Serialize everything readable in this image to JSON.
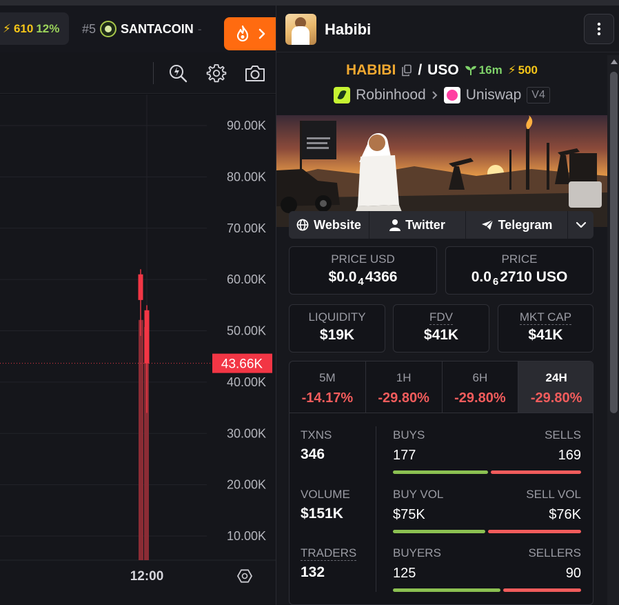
{
  "trending": {
    "prev_value": "610",
    "prev_change": "12%",
    "rank": "#5",
    "name": "SANTACOIN",
    "trail": "-"
  },
  "chart": {
    "y_ticks": [
      "90.00K",
      "80.00K",
      "70.00K",
      "60.00K",
      "50.00K",
      "40.00K",
      "30.00K",
      "20.00K",
      "10.00K"
    ],
    "current_price_label": "43.66K",
    "x_tick": "12:00",
    "colors": {
      "down": "#f23645",
      "volume": "#8b2c35"
    },
    "candles": [
      {
        "open": 56000,
        "close": 61000,
        "high": 62000,
        "low": 49000,
        "color": "down"
      },
      {
        "open": 54000,
        "close": 43660,
        "high": 55000,
        "low": 34000,
        "color": "down"
      }
    ],
    "volume_relative": [
      0.68,
      0.66
    ]
  },
  "token": {
    "name": "Habibi",
    "base_symbol": "HABIBI",
    "quote_symbol": "USO",
    "age": "16m",
    "boosts": "500",
    "chain": "Robinhood",
    "dex": "Uniswap",
    "dex_version": "V4"
  },
  "links": [
    "Website",
    "Twitter",
    "Telegram"
  ],
  "price": {
    "usd_label": "PRICE USD",
    "usd_prefix": "$0.0",
    "usd_zeros": "4",
    "usd_digits": "4366",
    "native_label": "PRICE",
    "native_prefix": "0.0",
    "native_zeros": "6",
    "native_digits": "2710 USO"
  },
  "metrics": [
    {
      "label": "LIQUIDITY",
      "value": "$19K"
    },
    {
      "label": "FDV",
      "value": "$41K"
    },
    {
      "label": "MKT CAP",
      "value": "$41K"
    }
  ],
  "timeframes": [
    {
      "label": "5M",
      "change": "-14.17%"
    },
    {
      "label": "1H",
      "change": "-29.80%"
    },
    {
      "label": "6H",
      "change": "-29.80%"
    },
    {
      "label": "24H",
      "change": "-29.80%"
    }
  ],
  "stats": {
    "txns": {
      "label": "TXNS",
      "value": "346"
    },
    "buys": {
      "label": "BUYS",
      "value": "177"
    },
    "sells": {
      "label": "SELLS",
      "value": "169"
    },
    "volume": {
      "label": "VOLUME",
      "value": "$151K"
    },
    "buy_vol": {
      "label": "BUY VOL",
      "value": "$75K"
    },
    "sell_vol": {
      "label": "SELL VOL",
      "value": "$76K"
    },
    "traders": {
      "label": "TRADERS",
      "value": "132"
    },
    "buyers": {
      "label": "BUYERS",
      "value": "125"
    },
    "sellers": {
      "label": "SELLERS",
      "value": "90"
    },
    "buy_share": 0.512,
    "buy_vol_share": 0.497,
    "buyer_share": 0.581
  },
  "colors": {
    "accent_orange": "#ff6b10",
    "base_symbol": "#f0a830",
    "positive": "#8cc152",
    "negative": "#f25c5c",
    "boost": "#f5c518"
  }
}
